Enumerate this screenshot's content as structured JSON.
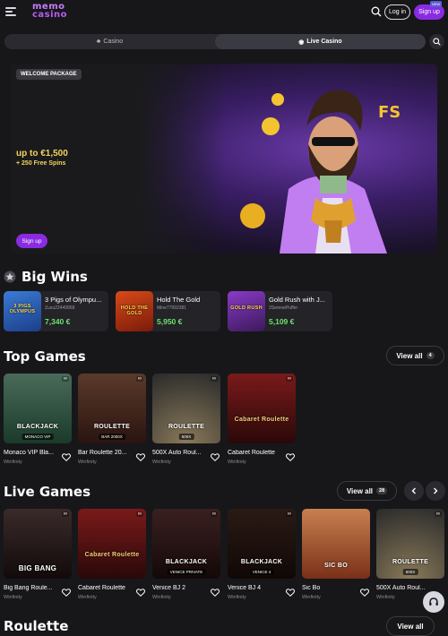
{
  "header": {
    "logo_line1": "memo",
    "logo_line2": "casino",
    "login_label": "Log in",
    "signup_label": "Sign up",
    "new_badge": "NEW"
  },
  "switcher": {
    "tabs": [
      {
        "label": "Casino",
        "icon": "cards-icon",
        "active": false
      },
      {
        "label": "Live Casino",
        "icon": "live-icon",
        "active": true
      }
    ]
  },
  "banner": {
    "tag": "WELCOME PACKAGE",
    "headline": "up to €1,500",
    "subline": "+ 250 Free Spins",
    "cta": "Sign up",
    "art_text": "FS"
  },
  "big_wins": {
    "title": "Big Wins",
    "items": [
      {
        "game": "3 Pigs of Olympu...",
        "user": "Zuzu22449958",
        "amount": "7,340 €",
        "thumb_text": "3 PIGS OLYMPUS"
      },
      {
        "game": "Hold The Gold",
        "user": "Mine77992381",
        "amount": "5,950 €",
        "thumb_text": "HOLD THE GOLD"
      },
      {
        "game": "Gold Rush with J...",
        "user": "2SerenePuffer",
        "amount": "5,109 €",
        "thumb_text": "GOLD RUSH"
      }
    ]
  },
  "top_games": {
    "title": "Top Games",
    "view_all": "View all",
    "count": "4",
    "items": [
      {
        "name": "Monaco VIP Bla...",
        "provider": "Winfinity",
        "label": "BLACKJACK",
        "sub": "MONACO VIP"
      },
      {
        "name": "Bar Roulette 20...",
        "provider": "Winfinity",
        "label": "ROULETTE",
        "sub": "BAR 2000X"
      },
      {
        "name": "500X Auto Roul...",
        "provider": "Winfinity",
        "label": "ROULETTE",
        "sub": "500X"
      },
      {
        "name": "Cabaret Roulette",
        "provider": "Winfinity",
        "label": "Cabaret Roulette",
        "sub": ""
      }
    ]
  },
  "live_games": {
    "title": "Live Games",
    "view_all": "View all",
    "count": "28",
    "items": [
      {
        "name": "Big Bang Roule...",
        "provider": "Winfinity",
        "label": "BIG BANG",
        "sub": ""
      },
      {
        "name": "Cabaret Roulette",
        "provider": "Winfinity",
        "label": "Cabaret Roulette",
        "sub": ""
      },
      {
        "name": "Venice BJ 2",
        "provider": "Winfinity",
        "label": "BLACKJACK",
        "sub": "VENICE PRIVATE"
      },
      {
        "name": "Venice BJ 4",
        "provider": "Winfinity",
        "label": "BLACKJACK",
        "sub": "VENICE 4"
      },
      {
        "name": "Sic Bo",
        "provider": "Winfinity",
        "label": "SIC BO",
        "sub": ""
      },
      {
        "name": "500X Auto Roul...",
        "provider": "Winfinity",
        "label": "ROULETTE",
        "sub": "500X"
      }
    ]
  },
  "next_section": {
    "title": "Roulette",
    "view_all": "View all"
  },
  "colors": {
    "accent": "#8a2be2",
    "win_green": "#6ee26a",
    "promo_gold": "#f2d45c",
    "background": "#17171a"
  }
}
